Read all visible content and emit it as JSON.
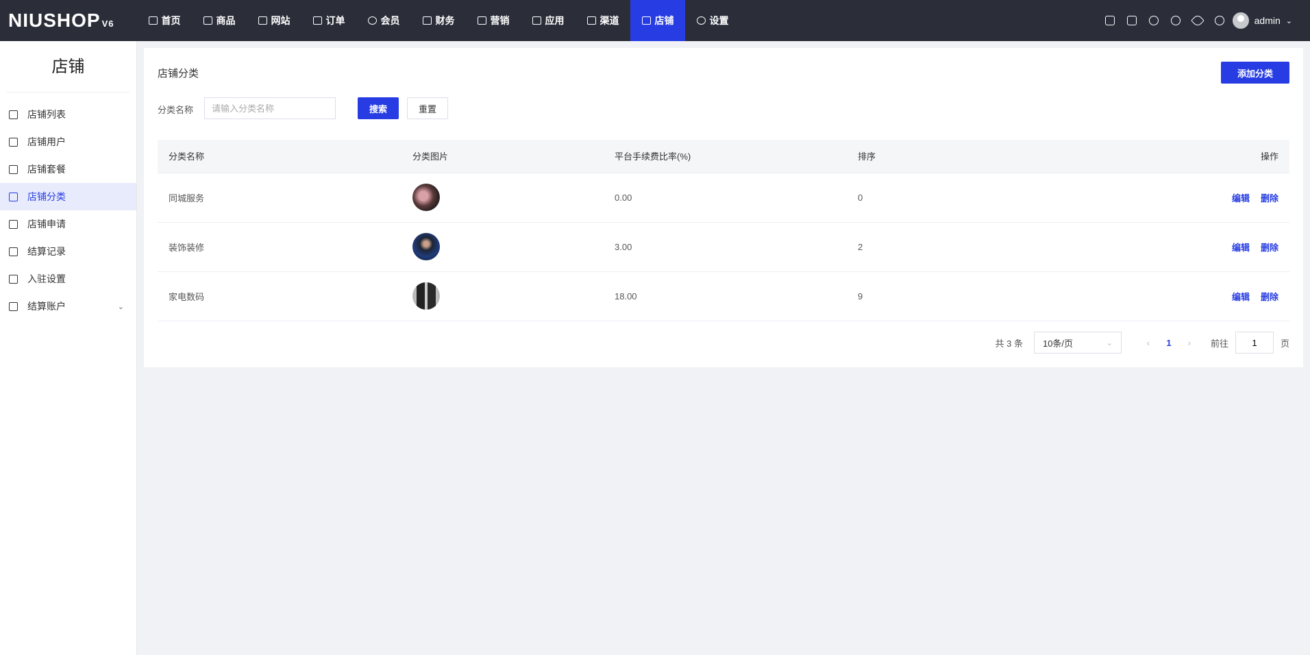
{
  "header": {
    "logo": "NIUSHOP",
    "logo_version": "V6",
    "nav": [
      {
        "label": "首页",
        "icon": "monitor-icon"
      },
      {
        "label": "商品",
        "icon": "box-icon"
      },
      {
        "label": "网站",
        "icon": "website-icon"
      },
      {
        "label": "订单",
        "icon": "clipboard-icon"
      },
      {
        "label": "会员",
        "icon": "user-icon"
      },
      {
        "label": "财务",
        "icon": "bag-icon"
      },
      {
        "label": "营销",
        "icon": "chart-icon"
      },
      {
        "label": "应用",
        "icon": "apps-icon"
      },
      {
        "label": "渠道",
        "icon": "channel-icon"
      },
      {
        "label": "店铺",
        "icon": "store-icon",
        "active": true
      },
      {
        "label": "设置",
        "icon": "gear-icon"
      }
    ],
    "user": "admin"
  },
  "sidebar": {
    "title": "店铺",
    "items": [
      {
        "label": "店铺列表"
      },
      {
        "label": "店铺用户"
      },
      {
        "label": "店铺套餐"
      },
      {
        "label": "店铺分类",
        "active": true
      },
      {
        "label": "店铺申请"
      },
      {
        "label": "结算记录"
      },
      {
        "label": "入驻设置"
      },
      {
        "label": "结算账户"
      }
    ]
  },
  "main": {
    "title": "店铺分类",
    "add_label": "添加分类",
    "filter": {
      "label": "分类名称",
      "placeholder": "请输入分类名称",
      "value": "",
      "search": "搜索",
      "reset": "重置"
    },
    "columns": [
      "分类名称",
      "分类图片",
      "平台手续费比率(%)",
      "排序",
      "操作"
    ],
    "rows": [
      {
        "name": "同城服务",
        "rate": "0.00",
        "sort": "0"
      },
      {
        "name": "装饰装修",
        "rate": "3.00",
        "sort": "2"
      },
      {
        "name": "家电数码",
        "rate": "18.00",
        "sort": "9"
      }
    ],
    "edit": "编辑",
    "delete": "删除",
    "pagination": {
      "total": "共 3 条",
      "page_size": "10条/页",
      "current": "1",
      "goto_label": "前往",
      "goto_value": "1",
      "page_suffix": "页"
    }
  },
  "colors": {
    "primary": "#273de3",
    "header": "#2b2e39"
  }
}
